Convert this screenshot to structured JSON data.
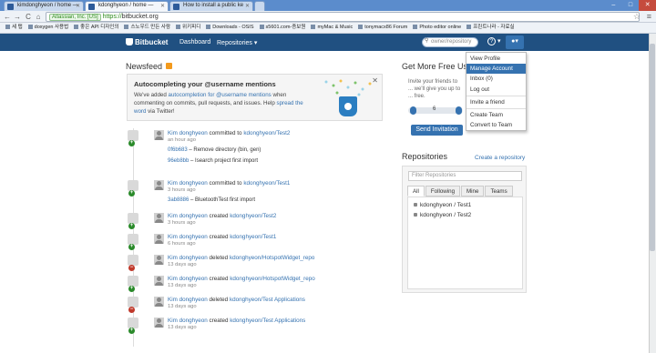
{
  "browser": {
    "tabs": [
      {
        "title": "kimdonghyeon / home —",
        "active": false
      },
      {
        "title": "kdonghyeon / home —",
        "active": true
      },
      {
        "title": "How to install a public ke",
        "active": false
      }
    ],
    "nav": {
      "back": "←",
      "forward": "→",
      "reload": "C",
      "home": "⌂"
    },
    "address": {
      "ev_label": "Atlassian, Inc. [US]",
      "scheme": "https://",
      "host": "bitbucket.org"
    },
    "window_controls": {
      "min": "–",
      "max": "□",
      "close": "✕"
    },
    "bookmarks": [
      "세 탭",
      "doxygen 사용법",
      "좋은 API 디자인의",
      "스노우드 만든 사람",
      "위키피디",
      "Downloads - OSIS",
      "s5601.com-증보원",
      "myMac & Music",
      "tonymacx86 Forum",
      "Photo editor online",
      "프린트나라 - 자료실"
    ]
  },
  "header": {
    "logo": "Bitbucket",
    "nav": [
      "Dashboard",
      "Repositories ▾"
    ],
    "search_placeholder": "owner/repository",
    "help": "?",
    "help_caret": "▾",
    "user_caret": "▾"
  },
  "newsfeed": {
    "title": "Newsfeed",
    "promo": {
      "title": "Autocompleting your @username mentions",
      "text_1": "We've added ",
      "link_1": "autocompletion for @username mentions",
      "text_2": " when commenting on commits, pull requests, and issues. Help ",
      "link_2": "spread the word",
      "text_3": " via Twitter!",
      "close": "✕"
    },
    "items": [
      {
        "user": "Kim donghyeon",
        "action": "committed to",
        "repo": "kdonghyeon/Test2",
        "time": "an hour ago",
        "badge": "plus",
        "commits": [
          {
            "hash": "0f6b683",
            "msg": " – Remove directory (bin, gen)"
          },
          {
            "hash": "96eb8bb",
            "msg": " – Isearch project first import"
          }
        ]
      },
      {
        "user": "Kim donghyeon",
        "action": "committed to",
        "repo": "kdonghyeon/Test1",
        "time": "3 hours ago",
        "badge": "plus",
        "commits": [
          {
            "hash": "3ab8886",
            "msg": " – BluetoothTest first import"
          }
        ]
      },
      {
        "user": "Kim donghyeon",
        "action": "created",
        "repo": "kdonghyeon/Test2",
        "time": "3 hours ago",
        "badge": "plus",
        "commits": []
      },
      {
        "user": "Kim donghyeon",
        "action": "created",
        "repo": "kdonghyeon/Test1",
        "time": "6 hours ago",
        "badge": "plus",
        "commits": []
      },
      {
        "user": "Kim donghyeon",
        "action": "deleted",
        "repo": "kdonghyeon/HotspotWidget_repo",
        "time": "13 days ago",
        "badge": "minus",
        "commits": []
      },
      {
        "user": "Kim donghyeon",
        "action": "created",
        "repo": "kdonghyeon/HotspotWidget_repo",
        "time": "13 days ago",
        "badge": "plus",
        "commits": []
      },
      {
        "user": "Kim donghyeon",
        "action": "deleted",
        "repo": "kdonghyeon/Test Applications",
        "time": "13 days ago",
        "badge": "minus",
        "commits": []
      },
      {
        "user": "Kim donghyeon",
        "action": "created",
        "repo": "kdonghyeon/Test Applications",
        "time": "13 days ago",
        "badge": "plus",
        "commits": []
      }
    ]
  },
  "sidebar": {
    "free_title": "Get More Free Us",
    "invite_text": "Invite your friends to ... we'll give you up to ... free.",
    "slider_value": "6",
    "send_button": "Send Invitation",
    "repos_title": "Repositories",
    "create_link": "Create a repository",
    "filter_placeholder": "Filter Repositories",
    "tabs": [
      "All",
      "Following",
      "Mine",
      "Teams"
    ],
    "repos": [
      "kdonghyeon / Test1",
      "kdonghyeon / Test2"
    ]
  },
  "user_menu": {
    "items": [
      "View Profile",
      "Manage Account",
      "Inbox (0)",
      "Log out",
      "Invite a friend",
      "Create Team",
      "Convert to Team"
    ],
    "highlighted_index": 1
  },
  "colors": {
    "header": "#205081",
    "link": "#3572b0",
    "add_badge": "#2a8a2a",
    "delete_badge": "#c0392b"
  }
}
